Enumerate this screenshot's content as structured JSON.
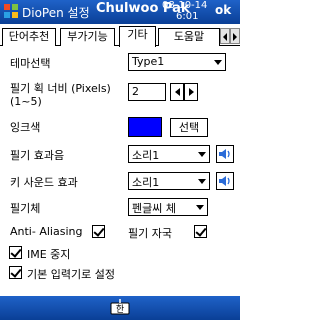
{
  "titlebar": {
    "title": "DioPen 설정",
    "user": "Chulwoo Pak",
    "date": "08-10-14",
    "time": "6:01",
    "ok_label": "ok"
  },
  "tabs": [
    {
      "label": "단어추천",
      "active": false
    },
    {
      "label": "부가기능",
      "active": false
    },
    {
      "label": "기타",
      "active": true
    },
    {
      "label": "도움말",
      "active": false
    }
  ],
  "settings": {
    "theme": {
      "label": "테마선택",
      "value": "Type1"
    },
    "stroke_width": {
      "label_line1": "필기 획 너비 (Pixels)",
      "label_line2": "(1~5)",
      "value": "2"
    },
    "ink_color": {
      "label": "잉크색",
      "color": "#0000ff",
      "button_label": "선택"
    },
    "stroke_sound": {
      "label": "필기 효과음",
      "value": "소리1"
    },
    "key_sound": {
      "label": "키 사운드 효과",
      "value": "소리1"
    },
    "font": {
      "label": "필기체",
      "value": "펜글씨 체"
    },
    "anti_aliasing": {
      "label": "Anti- Aliasing",
      "checked": true
    },
    "stroke_trace": {
      "label": "필기 자국",
      "checked": true
    },
    "ime_stop": {
      "label": "IME 중지",
      "checked": true
    },
    "default_input": {
      "label": "기본 입력기로 설정",
      "checked": true
    }
  },
  "bottombar": {
    "icon": "keyboard-icon"
  }
}
